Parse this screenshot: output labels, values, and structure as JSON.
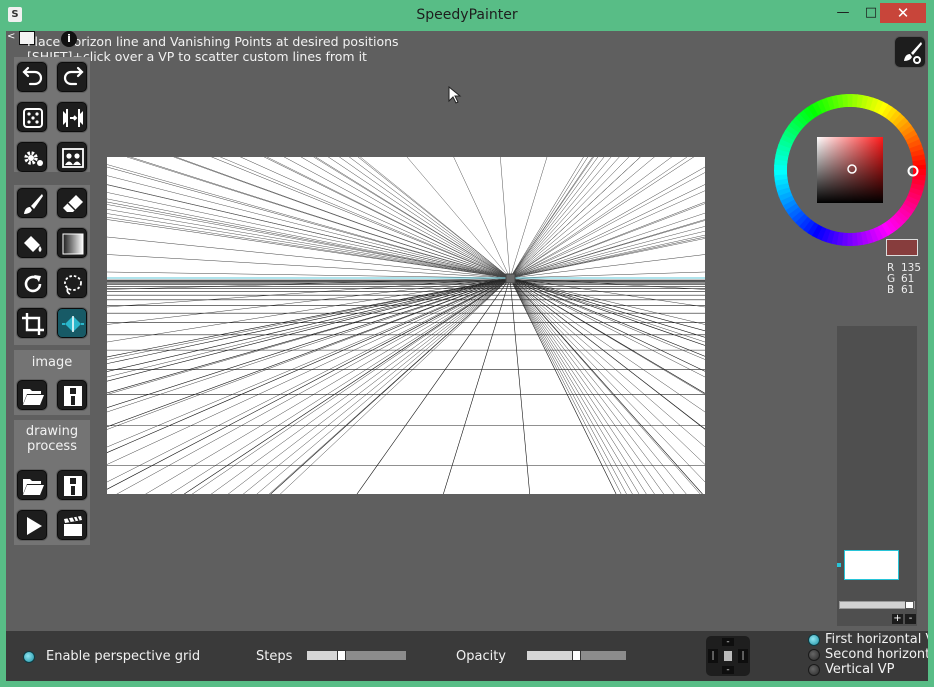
{
  "window": {
    "title": "SpeedyPainter",
    "app_icon": "S",
    "minimize_glyph": "—",
    "maximize_glyph": "□",
    "close_glyph": "✕"
  },
  "hints": {
    "line1": "Place Horizon line and Vanishing Points at desired positions",
    "line2": "[SHIFT]+click over a VP to scatter custom lines from it"
  },
  "toolbar": {
    "collapse_glyph": "<",
    "info_glyph": "i",
    "image_label": "image",
    "process_label": "drawing\nprocess",
    "tools": [
      {
        "name": "undo-icon"
      },
      {
        "name": "redo-icon"
      },
      {
        "name": "dice-icon"
      },
      {
        "name": "mirror-icon"
      },
      {
        "name": "gear-icon"
      },
      {
        "name": "reference-icon"
      },
      {
        "name": "brush-icon"
      },
      {
        "name": "eraser-icon"
      },
      {
        "name": "fill-bucket-icon"
      },
      {
        "name": "gradient-icon"
      },
      {
        "name": "rotate-icon"
      },
      {
        "name": "lasso-icon"
      },
      {
        "name": "crop-icon"
      },
      {
        "name": "perspective-icon"
      }
    ]
  },
  "color": {
    "current": "#873d3d",
    "r_label": "R",
    "g_label": "G",
    "b_label": "B",
    "r": "135",
    "g": "61",
    "b": "61"
  },
  "layers": {
    "add_glyph": "+",
    "remove_glyph": "-",
    "opacity_fraction": 1.0
  },
  "bottom": {
    "perspective_label": "Enable perspective grid",
    "steps_label": "Steps",
    "steps_fraction": 0.35,
    "opacity_label": "Opacity",
    "opacity_fraction": 0.5,
    "vp_options": [
      {
        "label": "First horizontal VP",
        "selected": true
      },
      {
        "label": "Second horizontal VP",
        "selected": false
      },
      {
        "label": "Vertical VP",
        "selected": false
      }
    ]
  },
  "accent": "#27c4d8"
}
